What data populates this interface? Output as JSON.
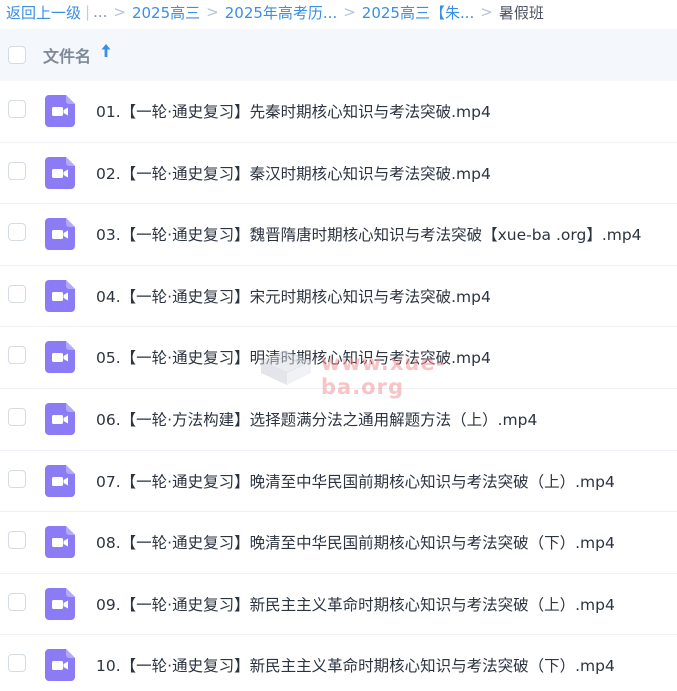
{
  "breadcrumb": {
    "back_label": "返回上一级",
    "ellipsis": "...",
    "items": [
      "2025高三",
      "2025年高考历...",
      "2025高三【朱...",
      "暑假班"
    ]
  },
  "header": {
    "column_label": "文件名",
    "sort_icon": "arrow-up-icon",
    "sort_direction": "ascending"
  },
  "files": [
    {
      "name": "01.【一轮·通史复习】先秦时期核心知识与考法突破.mp4",
      "icon": "video-file-icon"
    },
    {
      "name": "02.【一轮·通史复习】秦汉时期核心知识与考法突破.mp4",
      "icon": "video-file-icon"
    },
    {
      "name": "03.【一轮·通史复习】魏晋隋唐时期核心知识与考法突破【xue-ba .org】.mp4",
      "icon": "video-file-icon"
    },
    {
      "name": "04.【一轮·通史复习】宋元时期核心知识与考法突破.mp4",
      "icon": "video-file-icon"
    },
    {
      "name": "05.【一轮·通史复习】明清时期核心知识与考法突破.mp4",
      "icon": "video-file-icon"
    },
    {
      "name": "06.【一轮·方法构建】选择题满分法之通用解题方法（上）.mp4",
      "icon": "video-file-icon"
    },
    {
      "name": "07.【一轮·通史复习】晚清至中华民国前期核心知识与考法突破（上）.mp4",
      "icon": "video-file-icon"
    },
    {
      "name": "08.【一轮·通史复习】晚清至中华民国前期核心知识与考法突破（下）.mp4",
      "icon": "video-file-icon"
    },
    {
      "name": "09.【一轮·通史复习】新民主主义革命时期核心知识与考法突破（上）.mp4",
      "icon": "video-file-icon"
    },
    {
      "name": "10.【一轮·通史复习】新民主主义革命时期核心知识与考法突破（下）.mp4",
      "icon": "video-file-icon"
    }
  ],
  "watermark": {
    "text": "www.xue-ba.org",
    "icon": "book-logo-icon"
  },
  "colors": {
    "link": "#3a8ee6",
    "video_icon": "#8b7cf6",
    "header_bg": "#f4f8fd",
    "text": "#2c3440"
  }
}
